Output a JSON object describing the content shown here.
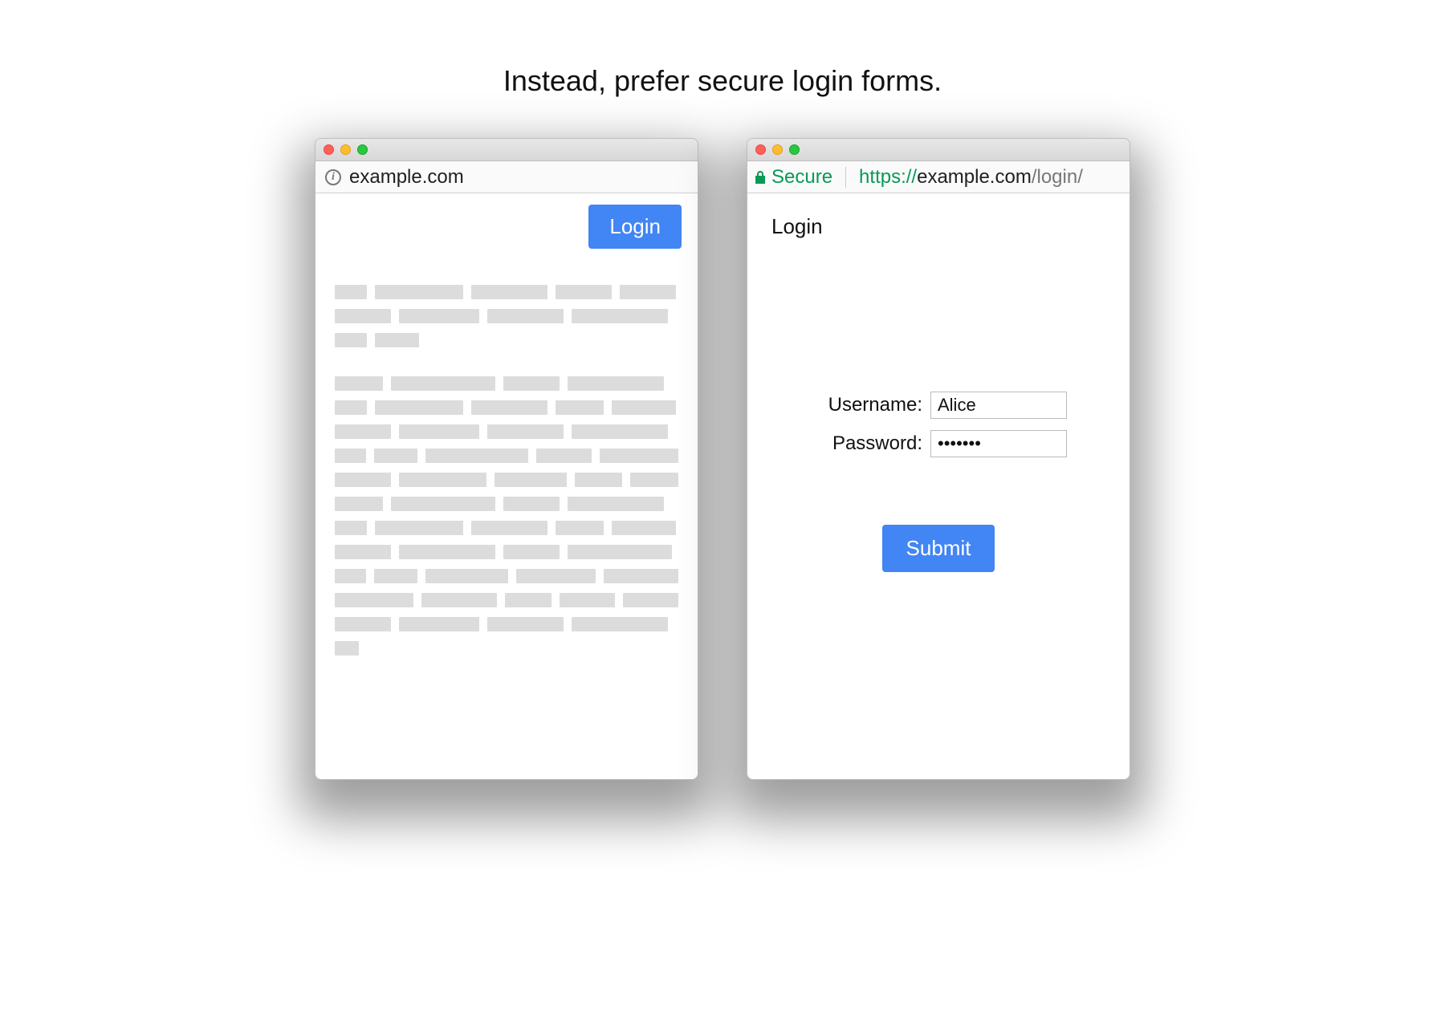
{
  "headline": "Instead, prefer secure login forms.",
  "traffic_light_colors": {
    "red": "#ff5f57",
    "yellow": "#ffbd2e",
    "green": "#28c940"
  },
  "left": {
    "address_url": "example.com",
    "login_button_label": "Login"
  },
  "right": {
    "secure_badge_label": "Secure",
    "url_scheme": "https://",
    "url_host": "example.com",
    "url_path": "/login/",
    "page_title": "Login",
    "username_label": "Username:",
    "username_value": "Alice",
    "password_label": "Password:",
    "password_value": "•••••••",
    "submit_label": "Submit"
  }
}
